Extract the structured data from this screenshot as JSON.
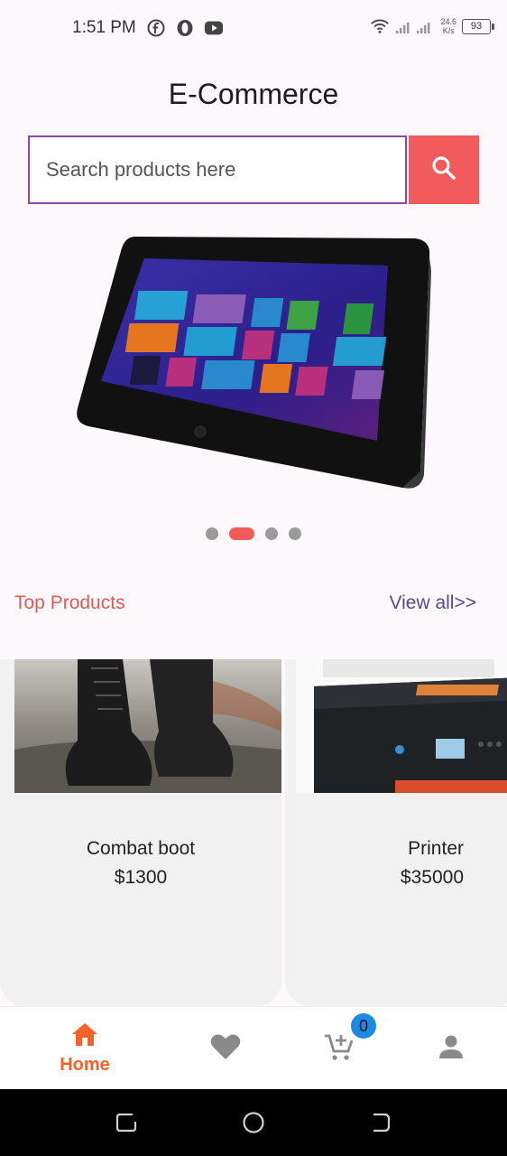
{
  "status": {
    "time": "1:51 PM",
    "speed_value": "24.6",
    "speed_unit": "K/s",
    "battery": "93"
  },
  "app": {
    "title": "E-Commerce"
  },
  "search": {
    "placeholder": "Search products here"
  },
  "carousel": {
    "slide_count": 4,
    "active_index": 1
  },
  "top_products": {
    "title": "Top Products",
    "view_all": "View all>>",
    "items": [
      {
        "name": "Combat boot",
        "price": "$1300"
      },
      {
        "name": "Printer",
        "price": "$35000"
      }
    ]
  },
  "bottom_nav": {
    "home_label": "Home",
    "cart_count": "0",
    "active_color": "#f4622a",
    "inactive_color": "#8a8a8a"
  },
  "colors": {
    "accent": "#f15b5b",
    "search_border": "#8e44ad",
    "badge": "#1e88e5"
  }
}
